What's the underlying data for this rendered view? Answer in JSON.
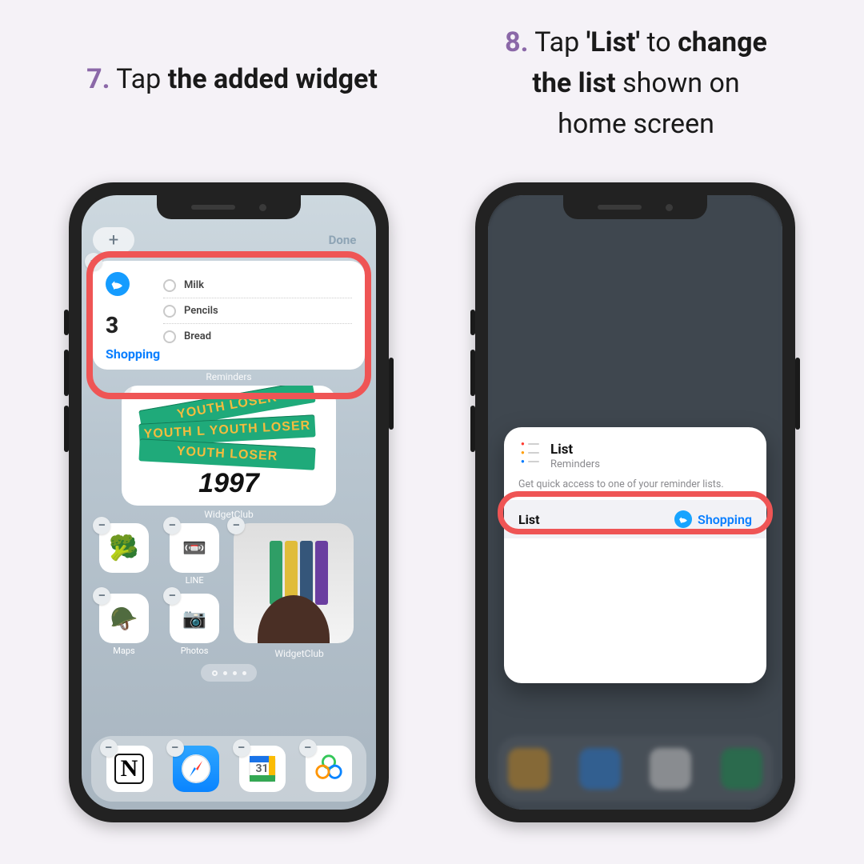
{
  "step7": {
    "num": "7.",
    "before": "Tap ",
    "bold": "the added widget"
  },
  "step8": {
    "num": "8.",
    "p1_before": "Tap ",
    "p1_bold1": "'List'",
    "p1_mid": " to ",
    "p1_bold2": "change",
    "p2_bold": "the list",
    "p2_after": " shown on",
    "p3": "home screen"
  },
  "phone1": {
    "addIcon": "+",
    "done": "Done",
    "remindersWidget": {
      "count": "3",
      "listName": "Shopping",
      "items": [
        "Milk",
        "Pencils",
        "Bread"
      ],
      "footerLabel": "Reminders"
    },
    "youth": {
      "lines": [
        "YOUTH LOSER",
        "YOUTH L  YOUTH LOSER",
        "YOUTH LOSER"
      ],
      "year": "1997",
      "label": "WidgetClub"
    },
    "apps": {
      "a1": "",
      "a2": "LINE",
      "a3": "Maps",
      "a4": "Photos",
      "bigLabel": "WidgetClub"
    },
    "dock": {
      "notion": "N",
      "cal": "31"
    }
  },
  "phone2": {
    "card": {
      "title": "List",
      "subtitle": "Reminders",
      "desc": "Get quick access to one of your reminder lists.",
      "rowLeft": "List",
      "rowRight": "Shopping"
    }
  }
}
